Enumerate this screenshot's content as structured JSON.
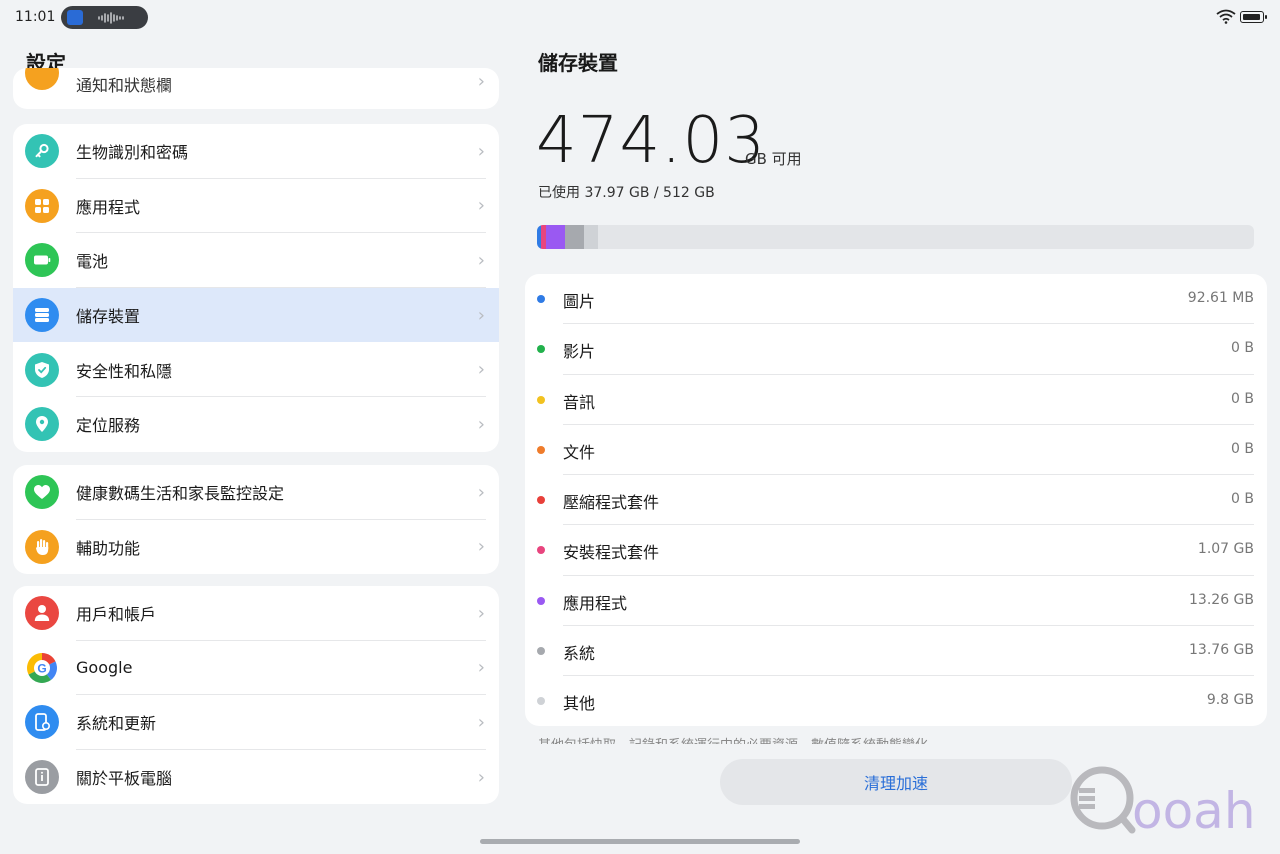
{
  "status": {
    "time": "11:01"
  },
  "left": {
    "title": "設定",
    "partial_item": "通知和狀態欄",
    "groups": [
      [
        {
          "label": "生物識別和密碼",
          "icon": "key-icon",
          "color": "#33c3b4"
        },
        {
          "label": "應用程式",
          "icon": "apps-icon",
          "color": "#f5a11f"
        },
        {
          "label": "電池",
          "icon": "battery-icon",
          "color": "#2ec556"
        },
        {
          "label": "儲存裝置",
          "icon": "storage-icon",
          "color": "#2f8cf0",
          "active": true
        },
        {
          "label": "安全性和私隱",
          "icon": "shield-icon",
          "color": "#33c3b4"
        },
        {
          "label": "定位服務",
          "icon": "location-icon",
          "color": "#33c3b4"
        }
      ],
      [
        {
          "label": "健康數碼生活和家長監控設定",
          "icon": "heart-icon",
          "color": "#2ec556"
        },
        {
          "label": "輔助功能",
          "icon": "hand-icon",
          "color": "#f5a11f"
        }
      ],
      [
        {
          "label": "用戶和帳戶",
          "icon": "user-icon",
          "color": "#ea4741"
        },
        {
          "label": "Google",
          "icon": "google-icon",
          "color": "#ffffff"
        },
        {
          "label": "系統和更新",
          "icon": "system-update-icon",
          "color": "#2f8cf0"
        },
        {
          "label": "關於平板電腦",
          "icon": "info-icon",
          "color": "#9a9da2"
        }
      ]
    ]
  },
  "right": {
    "title": "儲存裝置",
    "available": "474.03",
    "available_unit": "GB 可用",
    "used_text": "已使用 37.97 GB / 512 GB",
    "usage_bar": [
      {
        "name": "圖片",
        "percent": 0.5,
        "color": "#2f7be5"
      },
      {
        "name": "安裝程式套件",
        "percent": 0.8,
        "color": "#e8457e"
      },
      {
        "name": "應用程式",
        "percent": 2.6,
        "color": "#9a59f2"
      },
      {
        "name": "系統",
        "percent": 2.7,
        "color": "#a6a9ae"
      },
      {
        "name": "其他",
        "percent": 1.9,
        "color": "#cfd2d6"
      }
    ],
    "items": [
      {
        "name": "圖片",
        "size": "92.61 MB",
        "color": "#2f7be5"
      },
      {
        "name": "影片",
        "size": "0 B",
        "color": "#22b14c"
      },
      {
        "name": "音訊",
        "size": "0 B",
        "color": "#f2c220"
      },
      {
        "name": "文件",
        "size": "0 B",
        "color": "#ef7c2b"
      },
      {
        "name": "壓縮程式套件",
        "size": "0 B",
        "color": "#e8403a"
      },
      {
        "name": "安裝程式套件",
        "size": "1.07 GB",
        "color": "#e8457e"
      },
      {
        "name": "應用程式",
        "size": "13.26 GB",
        "color": "#9a59f2"
      },
      {
        "name": "系統",
        "size": "13.76 GB",
        "color": "#a6a9ae"
      },
      {
        "name": "其他",
        "size": "9.8 GB",
        "color": "#cfd2d6"
      }
    ],
    "note": "其他包括快取、記錄和系統運行中的必要資源。數值隨系統動態變化。",
    "clean_button": "清理加速"
  },
  "watermark": "Qooah"
}
